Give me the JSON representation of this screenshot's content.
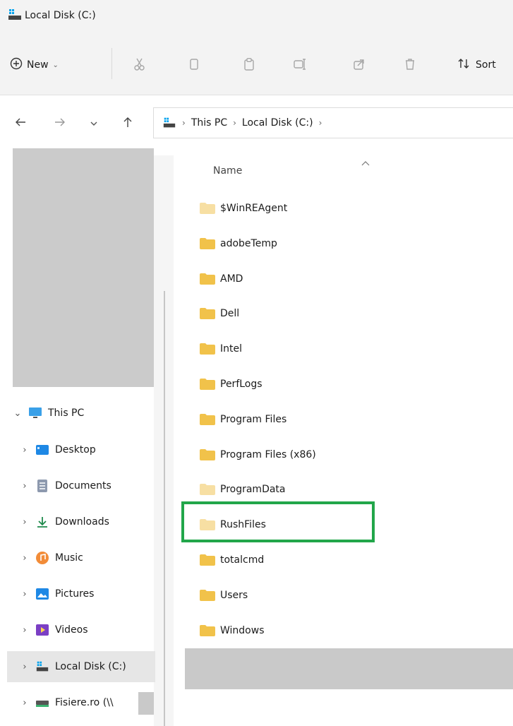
{
  "window": {
    "title": "Local Disk (C:)"
  },
  "commands": {
    "new_label": "New",
    "sort_label": "Sort"
  },
  "address": {
    "crumbs": [
      "This PC",
      "Local Disk (C:)"
    ]
  },
  "list": {
    "column_name": "Name",
    "files": [
      "$WinREAgent",
      "adobeTemp",
      "AMD",
      "Dell",
      "Intel",
      "PerfLogs",
      "Program Files",
      "Program Files (x86)",
      "ProgramData",
      "RushFiles",
      "totalcmd",
      "Users",
      "Windows"
    ]
  },
  "tree": {
    "this_pc": "This PC",
    "items": [
      "Desktop",
      "Documents",
      "Downloads",
      "Music",
      "Pictures",
      "Videos",
      "Local Disk (C:)",
      "Fisiere.ro (\\\\"
    ]
  },
  "colors": {
    "highlight": "#22a64a",
    "folder": "#f1c24a",
    "folder_light": "#f7dfa3"
  }
}
